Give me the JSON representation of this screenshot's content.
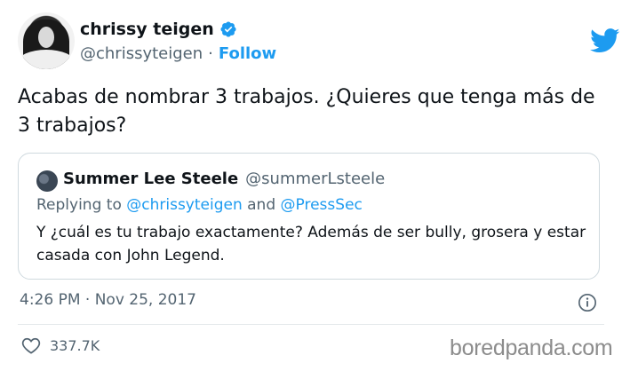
{
  "author": {
    "name": "chrissy teigen",
    "handle": "@chrissyteigen",
    "separator": "·",
    "follow_label": "Follow"
  },
  "tweet": {
    "text": "Acabas de nombrar 3 trabajos. ¿Quieres que tenga más de 3 trabajos?",
    "timestamp": "4:26 PM · Nov 25, 2017"
  },
  "quoted": {
    "name": "Summer Lee Steele",
    "handle": "@summerLsteele",
    "replying_prefix": "Replying to",
    "replying_to_1": "@chrissyteigen",
    "replying_and": "and",
    "replying_to_2": "@PressSec",
    "text": "Y ¿cuál es tu trabajo exactamente? Además de ser bully, grosera y estar casada con John Legend."
  },
  "engagement": {
    "likes": "337.7K"
  },
  "watermark": "boredpanda.com",
  "icons": {
    "verified": "verified-badge-icon",
    "logo": "twitter-bird-icon",
    "info": "info-icon",
    "like": "heart-icon"
  },
  "colors": {
    "accent": "#1d9bf0",
    "text": "#0f1419",
    "secondary": "#536471",
    "border": "#cfd9de"
  }
}
